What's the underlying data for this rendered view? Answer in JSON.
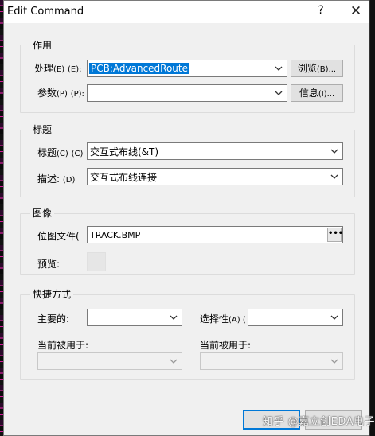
{
  "window": {
    "title": "Edit Command",
    "help": "?",
    "close": "✕"
  },
  "function_group": {
    "title": "作用",
    "process": {
      "label": "处理",
      "hint": "(E)",
      "mnemonic": "(E):",
      "value": "PCB:AdvancedRoute"
    },
    "browse_button": {
      "label": "浏览",
      "hint": "(B)",
      "rest": "(B)..."
    },
    "params": {
      "label": "参数",
      "hint": "(P)",
      "mnemonic": "(P):",
      "value": ""
    },
    "info_button": {
      "label": "信息",
      "hint": "(I)",
      "rest": "(I)..."
    }
  },
  "title_group": {
    "title": "标题",
    "caption": {
      "label": "标题",
      "hint": "(C)",
      "mnemonic": "(C)",
      "value": "交互式布线(&T)"
    },
    "description": {
      "label": "描述:",
      "mnemonic": "(D)",
      "value": "交互式布线连接"
    }
  },
  "image_group": {
    "title": "图像",
    "bitmap": {
      "label": "位图文件(",
      "value": "TRACK.BMP",
      "button": "•••"
    },
    "preview": {
      "label": "预览:"
    }
  },
  "shortcut_group": {
    "title": "快捷方式",
    "primary": {
      "label": "主要的:",
      "value": ""
    },
    "alternative": {
      "label": "选择性",
      "hint": "(A) (",
      "value": ""
    },
    "current_used_left": {
      "label": "当前被用于:",
      "value": ""
    },
    "current_used_right": {
      "label": "当前被用于:",
      "value": ""
    }
  },
  "footer": {
    "ok_label": "",
    "cancel_label": "",
    "watermark": "知乎 @嘉立创EDA电子"
  },
  "colors": {
    "accent": "#0078d7",
    "dialog_bg": "#f0f0f0"
  }
}
